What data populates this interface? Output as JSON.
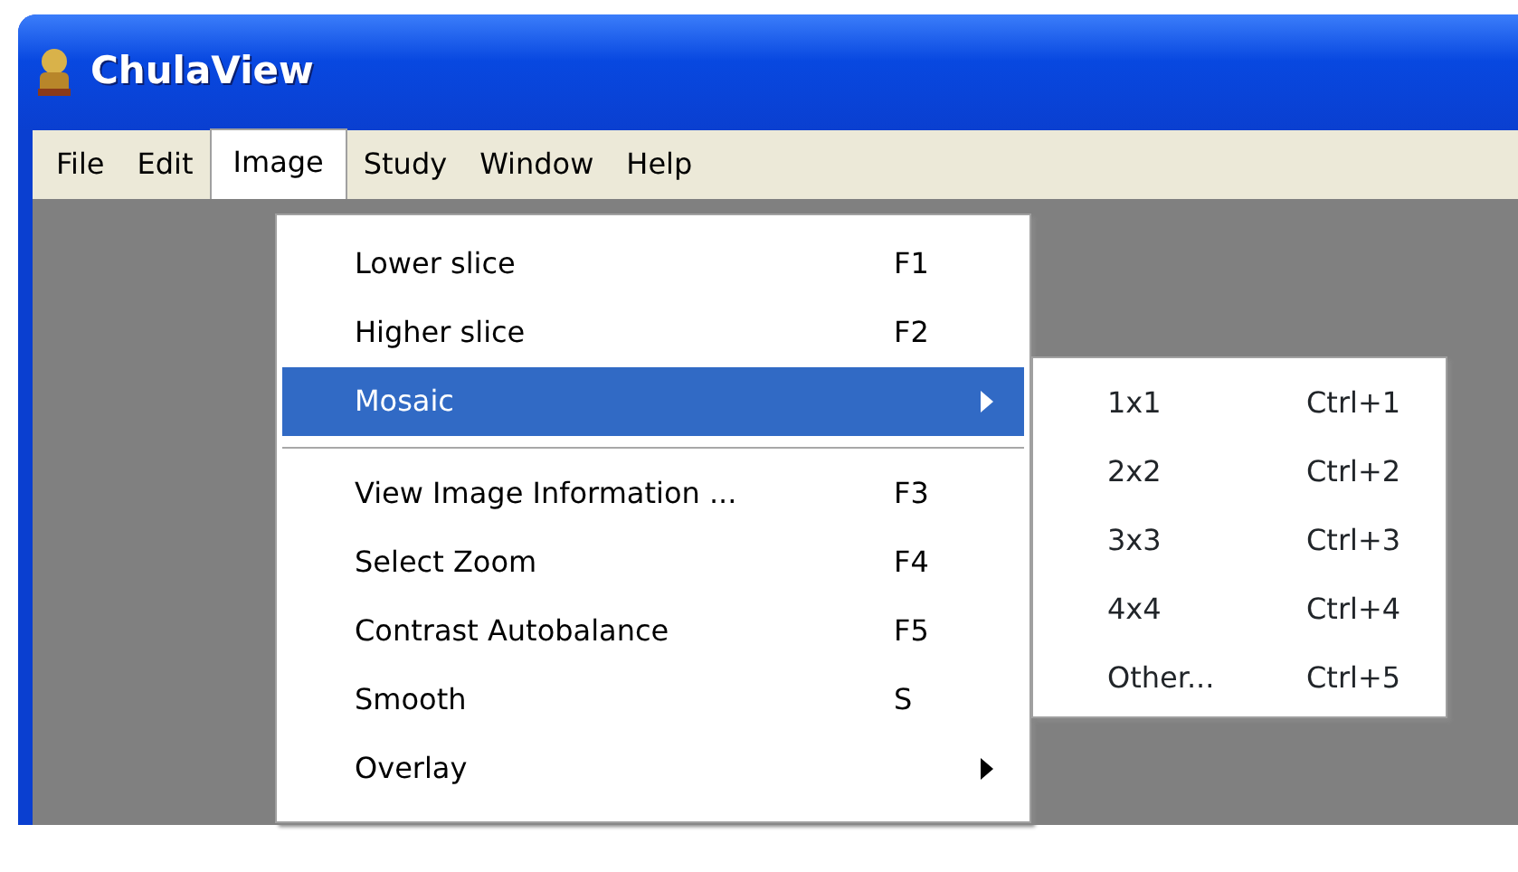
{
  "window": {
    "title": "ChulaView"
  },
  "menubar": [
    {
      "label": "File",
      "selected": false
    },
    {
      "label": "Edit",
      "selected": false
    },
    {
      "label": "Image",
      "selected": true
    },
    {
      "label": "Study",
      "selected": false
    },
    {
      "label": "Window",
      "selected": false
    },
    {
      "label": "Help",
      "selected": false
    }
  ],
  "menu": [
    {
      "kind": "item",
      "label": "Lower slice",
      "shortcut": "F1",
      "selected": false,
      "has_submenu": false
    },
    {
      "kind": "item",
      "label": "Higher slice",
      "shortcut": "F2",
      "selected": false,
      "has_submenu": false
    },
    {
      "kind": "item",
      "label": "Mosaic",
      "selected": true,
      "has_submenu": true
    },
    {
      "kind": "separator"
    },
    {
      "kind": "item",
      "label": "View Image Information ...",
      "shortcut": "F3",
      "selected": false,
      "has_submenu": false
    },
    {
      "kind": "item",
      "label": "Select Zoom",
      "shortcut": "F4",
      "selected": false,
      "has_submenu": false
    },
    {
      "kind": "item",
      "label": "Contrast Autobalance",
      "shortcut": "F5",
      "selected": false,
      "has_submenu": false
    },
    {
      "kind": "item",
      "label": "Smooth",
      "shortcut": "S",
      "selected": false,
      "has_submenu": false
    },
    {
      "kind": "item",
      "label": "Overlay",
      "selected": false,
      "has_submenu": true
    }
  ],
  "submenu": [
    {
      "label": "1x1",
      "shortcut": "Ctrl+1"
    },
    {
      "label": "2x2",
      "shortcut": "Ctrl+2"
    },
    {
      "label": "3x3",
      "shortcut": "Ctrl+3"
    },
    {
      "label": "4x4",
      "shortcut": "Ctrl+4"
    },
    {
      "label": "Other...",
      "shortcut": "Ctrl+5"
    }
  ]
}
